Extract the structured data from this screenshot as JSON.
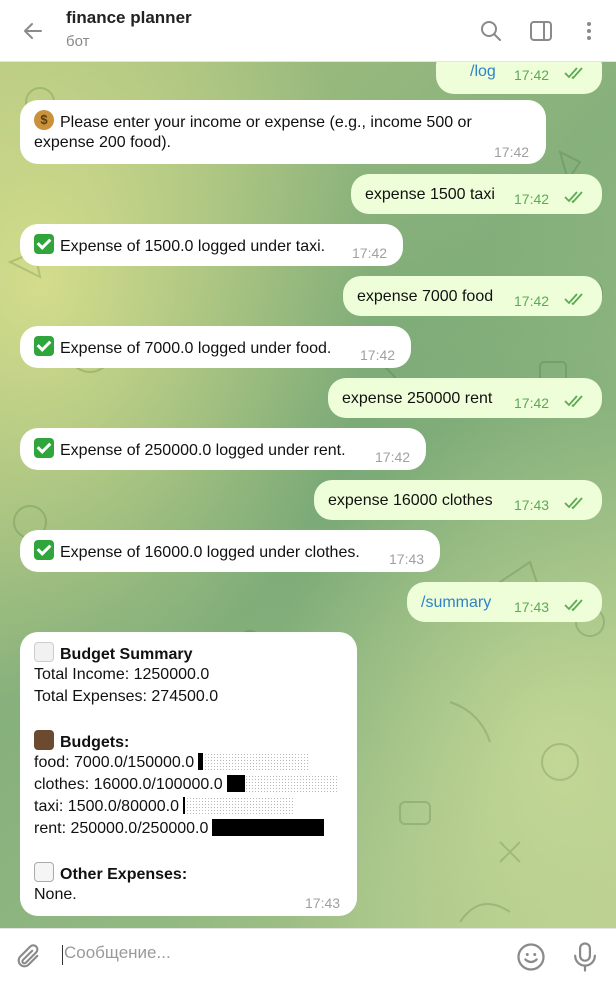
{
  "header": {
    "title": "finance planner",
    "subtitle": "бот"
  },
  "messages": [
    {
      "dir": "out",
      "text": "/log",
      "is_command": true,
      "time": "17:42"
    },
    {
      "dir": "in",
      "emoji": "moneybag",
      "text_line1": "Please enter your income or expense (e.g., income 500 or",
      "text_line2": "expense 200 food).",
      "time": "17:42"
    },
    {
      "dir": "out",
      "text": "expense 1500 taxi",
      "time": "17:42"
    },
    {
      "dir": "in",
      "emoji": "check",
      "text": "Expense of 1500.0 logged under taxi.",
      "time": "17:42"
    },
    {
      "dir": "out",
      "text": "expense 7000 food",
      "time": "17:42"
    },
    {
      "dir": "in",
      "emoji": "check",
      "text": "Expense of 7000.0 logged under food.",
      "time": "17:42"
    },
    {
      "dir": "out",
      "text": "expense 250000 rent",
      "time": "17:42"
    },
    {
      "dir": "in",
      "emoji": "check",
      "text": "Expense of 250000.0 logged under rent.",
      "time": "17:42"
    },
    {
      "dir": "out",
      "text": "expense 16000 clothes",
      "time": "17:43"
    },
    {
      "dir": "in",
      "emoji": "check",
      "text": "Expense of 16000.0 logged under clothes.",
      "time": "17:43"
    },
    {
      "dir": "out",
      "text": "/summary",
      "is_command": true,
      "time": "17:43"
    }
  ],
  "summary": {
    "heading": "Budget Summary",
    "total_income": "Total Income: 1250000.0",
    "total_expenses": "Total Expenses: 274500.0",
    "budgets_heading": "Budgets:",
    "budgets": [
      {
        "label": "food: 7000.0/150000.0",
        "fraction": 0.047
      },
      {
        "label": "clothes: 16000.0/100000.0",
        "fraction": 0.16
      },
      {
        "label": "taxi: 1500.0/80000.0",
        "fraction": 0.019
      },
      {
        "label": "rent: 250000.0/250000.0",
        "fraction": 1.0
      }
    ],
    "other_heading": "Other Expenses:",
    "other_value": "None.",
    "time": "17:43"
  },
  "input": {
    "placeholder": "Сообщение..."
  },
  "colors": {
    "outgoing_bubble": "#eefed9",
    "incoming_bubble": "#ffffff",
    "time_outgoing": "#5caa53",
    "command_link": "#2f82c9"
  }
}
